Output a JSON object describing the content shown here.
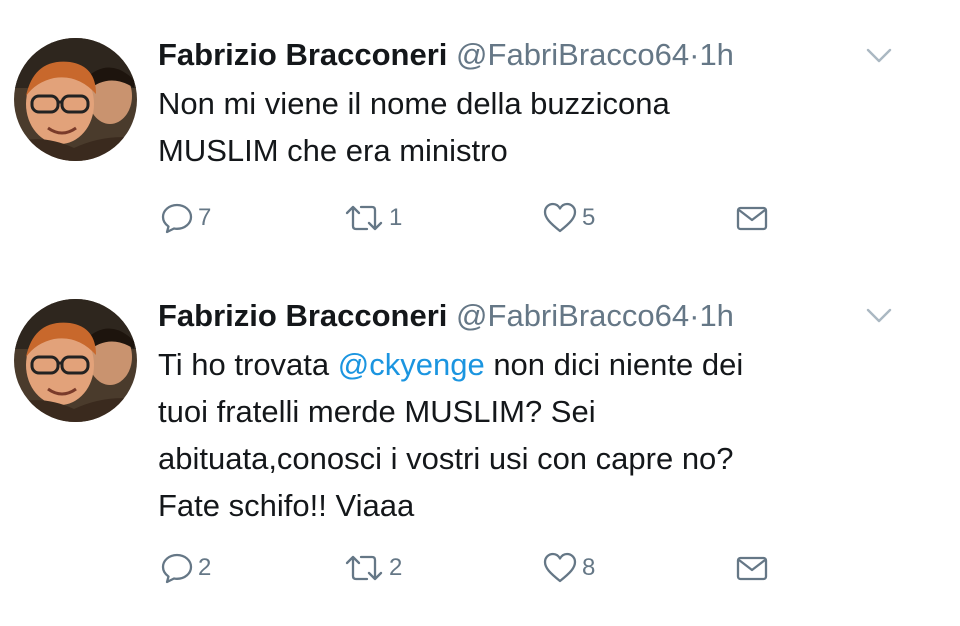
{
  "tweets": [
    {
      "name": "Fabrizio Bracconeri",
      "handle": "@FabriBracco64",
      "separator": "·",
      "time": "1h",
      "text_lines": [
        "Non mi viene il nome della buzzicona",
        "MUSLIM che era ministro"
      ],
      "replies": "7",
      "retweets": "1",
      "likes": "5"
    },
    {
      "name": "Fabrizio Bracconeri",
      "handle": "@FabriBracco64",
      "separator": "·",
      "time": "1h",
      "text_before_mention": "Ti ho trovata ",
      "mention": "@ckyenge",
      "text_after_mention": " non dici niente dei",
      "text_lines_rest": [
        "tuoi fratelli merde MUSLIM? Sei",
        "abituata,conosci i vostri usi con capre no?",
        "Fate schifo!! Viaaa"
      ],
      "replies": "2",
      "retweets": "2",
      "likes": "8"
    }
  ],
  "colors": {
    "text": "#14171a",
    "secondary": "#657786",
    "link": "#1b95e0",
    "background": "#ffffff"
  },
  "icons": [
    "avatar",
    "chevron-down-icon",
    "reply-icon",
    "retweet-icon",
    "heart-icon",
    "envelope-icon"
  ]
}
